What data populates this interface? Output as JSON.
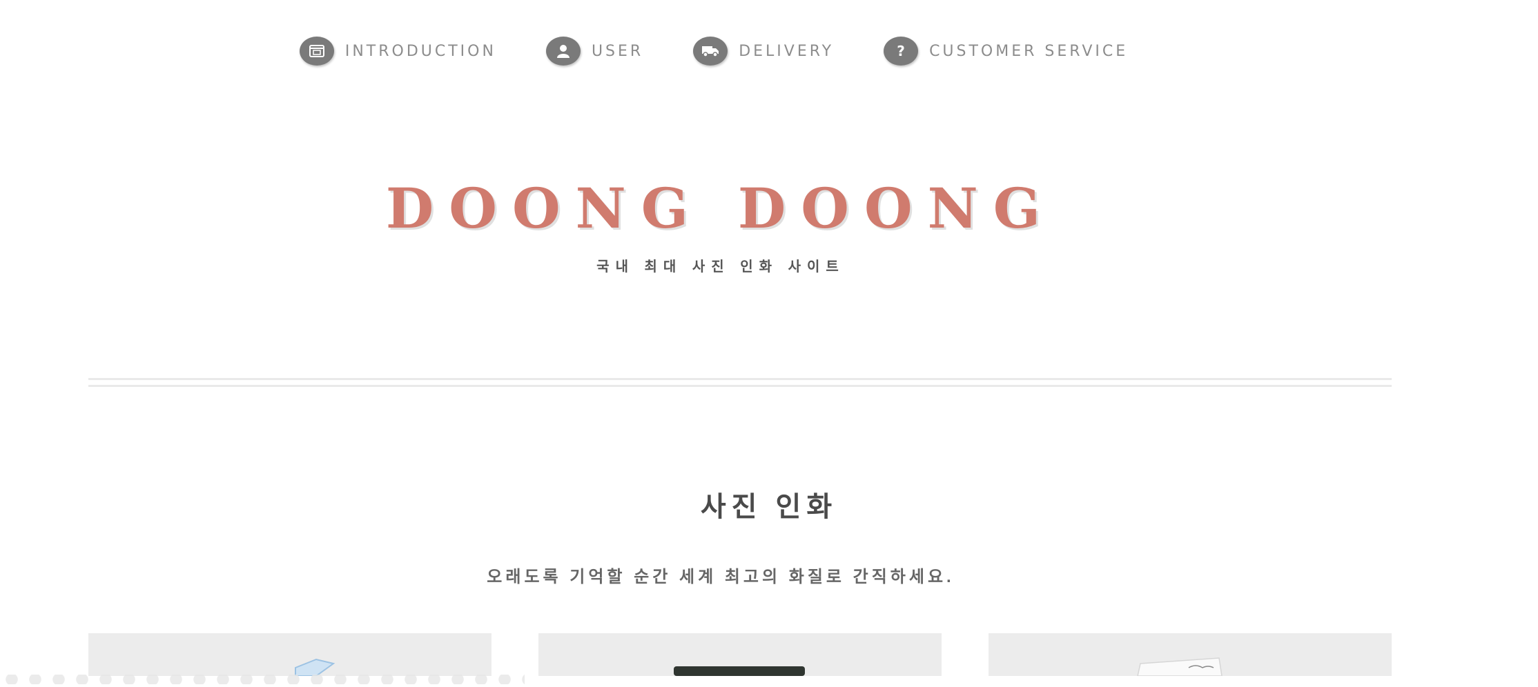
{
  "nav": {
    "items": [
      {
        "label": "INTRODUCTION",
        "icon": "browser-icon"
      },
      {
        "label": "USER",
        "icon": "user-icon"
      },
      {
        "label": "DELIVERY",
        "icon": "truck-icon"
      },
      {
        "label": "CUSTOMER SERVICE",
        "icon": "question-icon"
      }
    ]
  },
  "header": {
    "brand": "DOONG DOONG",
    "tagline": "국내 최대 사진 인화 사이트"
  },
  "section": {
    "title": "사진 인화",
    "subtitle": "오래도록 기억할 순간 세계 최고의 화질로 간직하세요."
  },
  "colors": {
    "brand": "#d07b6e",
    "icon_bg": "#7a7a7a",
    "card_bg": "#ececec"
  }
}
